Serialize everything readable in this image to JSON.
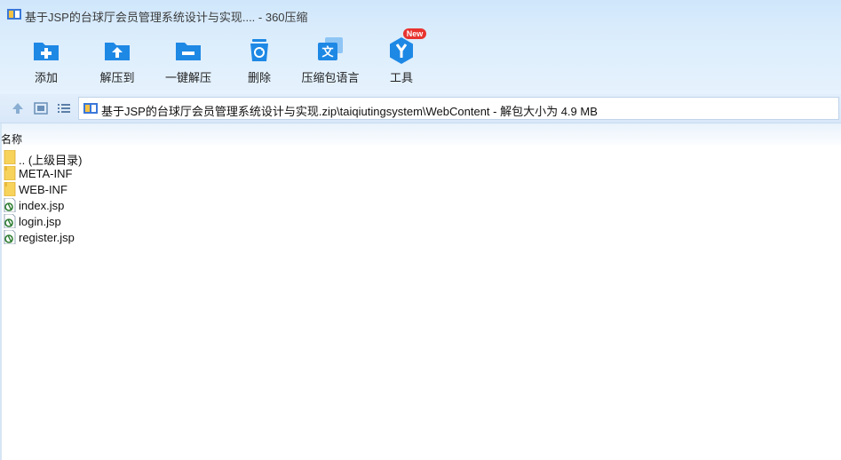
{
  "window": {
    "title": "基于JSP的台球厅会员管理系统设计与实现.... - 360压缩"
  },
  "toolbar": {
    "buttons": [
      {
        "label": "添加",
        "icon": "folder-add-icon"
      },
      {
        "label": "解压到",
        "icon": "folder-extract-icon"
      },
      {
        "label": "一键解压",
        "icon": "folder-onekey-extract-icon"
      },
      {
        "label": "删除",
        "icon": "recycle-bin-icon"
      },
      {
        "label": "压缩包语言",
        "icon": "language-icon"
      },
      {
        "label": "工具",
        "icon": "tools-icon"
      }
    ],
    "new_badge": "New"
  },
  "navbar": {
    "path": "基于JSP的台球厅会员管理系统设计与实现.zip\\taiqiutingsystem\\WebContent - 解包大小为 4.9 MB"
  },
  "list": {
    "column_header": "名称",
    "items": [
      {
        "name": ".. (上级目录)",
        "type": "folder"
      },
      {
        "name": "META-INF",
        "type": "folder"
      },
      {
        "name": "WEB-INF",
        "type": "folder"
      },
      {
        "name": "index.jsp",
        "type": "jsp"
      },
      {
        "name": "login.jsp",
        "type": "jsp"
      },
      {
        "name": "register.jsp",
        "type": "jsp"
      }
    ]
  },
  "colors": {
    "accent": "#1e88e5",
    "badge": "#e8332f",
    "folder": "#f7d35c"
  }
}
